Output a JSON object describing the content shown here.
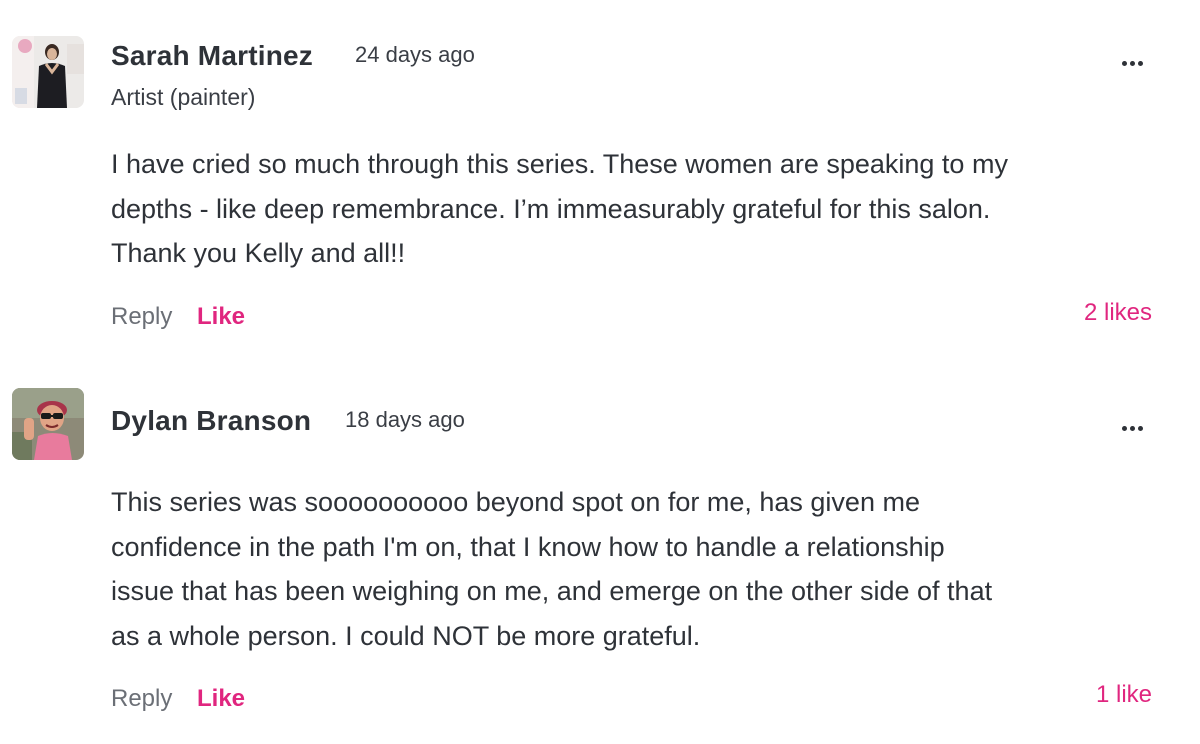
{
  "comments": [
    {
      "author": "Sarah Martinez",
      "timestamp": "24 days ago",
      "role": "Artist (painter)",
      "body_lines": [
        "I have cried so much through this series. These women are speaking to my",
        "depths - like deep remembrance. I’m immeasurably grateful for this salon.",
        "Thank you Kelly and all!!"
      ],
      "reply_label": "Reply",
      "like_label": "Like",
      "likes": "2 likes",
      "avatar_icon": "person-photo-avatar"
    },
    {
      "author": "Dylan Branson",
      "timestamp": "18 days ago",
      "body_lines": [
        "This series was soooooooooo beyond spot on for me, has given me",
        "confidence in the path I'm on, that I know how to handle a relationship",
        "issue that has been weighing on me, and emerge on the other side of that",
        "as a whole person. I could NOT be more grateful."
      ],
      "reply_label": "Reply",
      "like_label": "Like",
      "likes": "1 like",
      "avatar_icon": "person-photo-avatar"
    }
  ],
  "colors": {
    "accent": "#e0267f",
    "text": "#2e3238",
    "muted": "#6b6f76"
  },
  "icons": {
    "more": "more-options-icon"
  }
}
